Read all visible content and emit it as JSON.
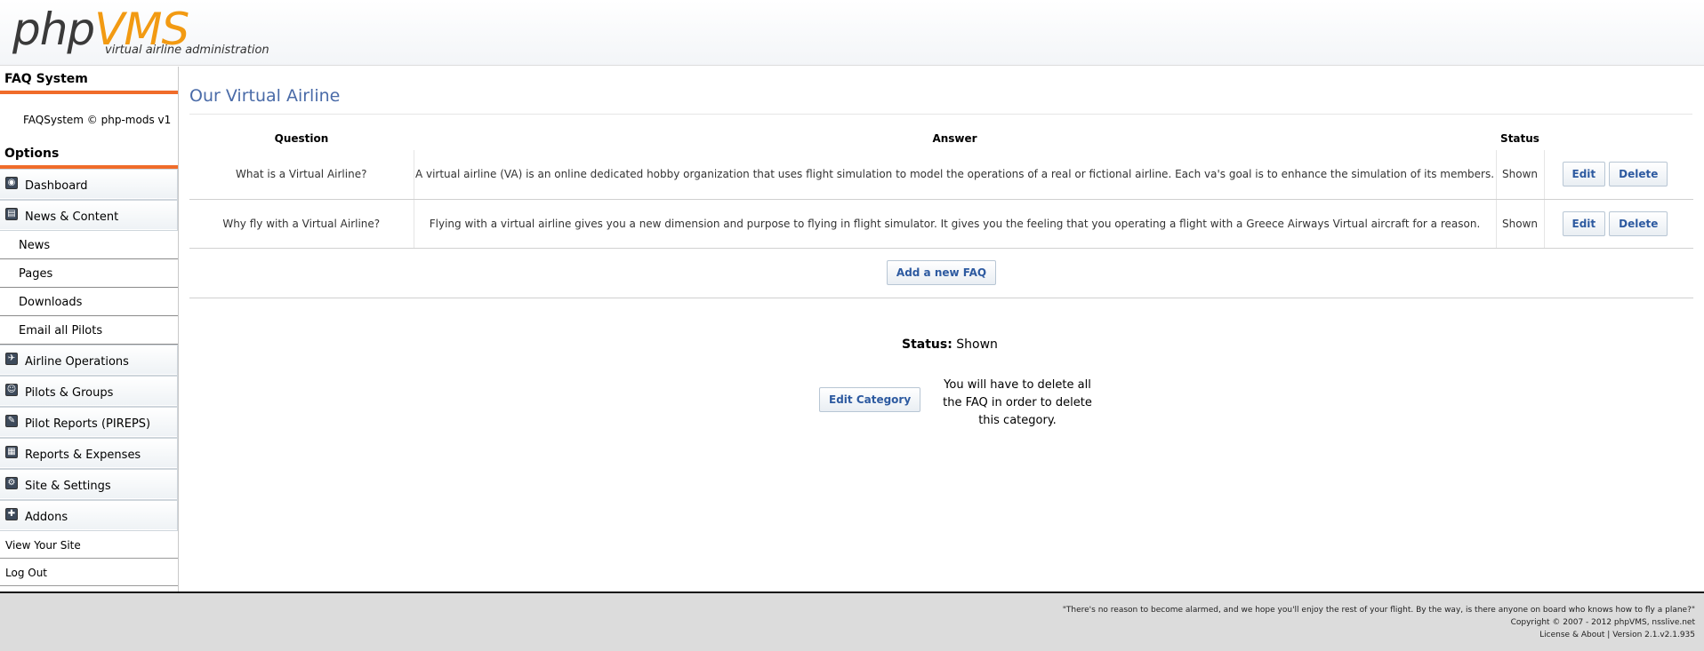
{
  "header": {
    "logo_part1": "php",
    "logo_part2": "VMS",
    "tagline": "virtual airline administration"
  },
  "sidebar": {
    "faq_heading": "FAQ System",
    "faq_note": "FAQSystem © php-mods v1",
    "options_heading": "Options",
    "items": [
      {
        "label": "Dashboard",
        "icon": "dashboard-icon"
      },
      {
        "label": "News & Content",
        "icon": "news-icon"
      },
      {
        "label": "News"
      },
      {
        "label": "Pages"
      },
      {
        "label": "Downloads"
      },
      {
        "label": "Email all Pilots"
      },
      {
        "label": "Airline Operations",
        "icon": "airline-icon"
      },
      {
        "label": "Pilots & Groups",
        "icon": "pilots-icon"
      },
      {
        "label": "Pilot Reports (PIREPS)",
        "icon": "pireps-icon"
      },
      {
        "label": "Reports & Expenses",
        "icon": "reports-icon"
      },
      {
        "label": "Site & Settings",
        "icon": "settings-icon"
      },
      {
        "label": "Addons",
        "icon": "addons-icon"
      },
      {
        "label": "View Your Site"
      },
      {
        "label": "Log Out"
      }
    ]
  },
  "main": {
    "title": "Our Virtual Airline",
    "columns": [
      "Question",
      "Answer",
      "Status"
    ],
    "rows": [
      {
        "question": "What is a Virtual Airline?",
        "answer": "A virtual airline (VA) is an online dedicated hobby organization that uses flight simulation to model the operations of a real or fictional airline. Each va's goal is to enhance the simulation of its members.",
        "status": "Shown"
      },
      {
        "question": "Why fly with a Virtual Airline?",
        "answer": "Flying with a virtual airline gives you a new dimension and purpose to flying in flight simulator. It gives you the feeling that you operating a flight with a Greece Airways Virtual aircraft for a reason.",
        "status": "Shown"
      }
    ],
    "edit_label": "Edit",
    "delete_label": "Delete",
    "add_label": "Add a new FAQ",
    "status_label": "Status:",
    "status_value": "Shown",
    "edit_category_label": "Edit Category",
    "category_note": "You will have to delete all the FAQ in order to delete this category."
  },
  "footer": {
    "quote": "\"There's no reason to become alarmed, and we hope you'll enjoy the rest of your flight. By the way, is there anyone on board who knows how to fly a plane?\"",
    "copyright": "Copyright © 2007 - 2012 phpVMS, nsslive.net",
    "license": "License & About | Version 2.1.v2.1.935"
  },
  "colors": {
    "accent_orange": "#f06c2a",
    "logo_orange": "#f29a12",
    "title_blue": "#4a6ba8",
    "button_text": "#2d5aa0"
  }
}
